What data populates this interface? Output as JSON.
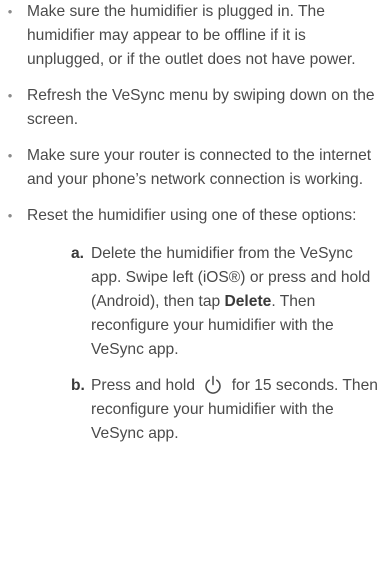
{
  "bullets": [
    "Make sure the humidifier is plugged in. The humidifier may appear to be offline if it is unplugged, or if the outlet does not have power.",
    "Refresh the VeSync menu by swiping down on the screen.",
    "Make sure your router is connected to the internet and your phone’s network connection is working.",
    "Reset the humidifier using one of these options:"
  ],
  "bullet_symbol": "•",
  "options": {
    "a": {
      "marker": "a.",
      "text_before": "Delete the humidifier from the VeSync app. Swipe left (iOS®) or press and hold (Android), then tap ",
      "bold": "Delete",
      "text_after": ". Then reconfigure your humidifier with the VeSync app."
    },
    "b": {
      "marker": "b.",
      "text_before": "Press and hold",
      "icon": "power-icon",
      "text_after": "for 15 seconds. Then reconfigure your humidifier with the VeSync app."
    }
  }
}
